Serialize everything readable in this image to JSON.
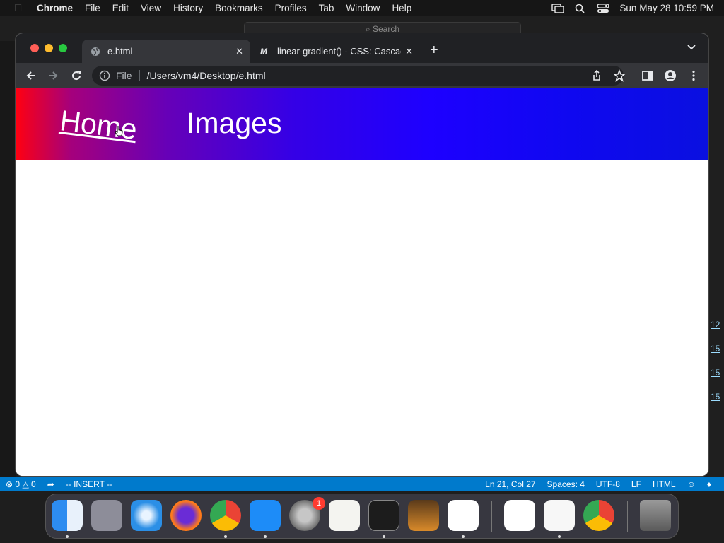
{
  "menubar": {
    "app_name": "Chrome",
    "menus": [
      "File",
      "Edit",
      "View",
      "History",
      "Bookmarks",
      "Profiles",
      "Tab",
      "Window",
      "Help"
    ],
    "clock": "Sun May 28  10:59 PM"
  },
  "background_editor": {
    "search_placeholder": "⌕ Search",
    "status": {
      "errors": "0",
      "warnings": "0",
      "mode": "-- INSERT --",
      "position": "Ln 21, Col 27",
      "spaces": "Spaces: 4",
      "encoding": "UTF-8",
      "eol": "LF",
      "language": "HTML"
    },
    "line_refs": [
      "12",
      "15",
      "15",
      "15"
    ]
  },
  "browser": {
    "tabs": [
      {
        "title": "e.html",
        "active": true,
        "icon": "globe-icon"
      },
      {
        "title": "linear-gradient() - CSS: Cascading",
        "active": false,
        "icon": "mdn-icon"
      }
    ],
    "address": {
      "scheme_label": "File",
      "url": "/Users/vm4/Desktop/e.html"
    }
  },
  "page": {
    "nav": {
      "home": "Home",
      "images": "Images"
    },
    "colors": {
      "gradient_start": "#ff0010",
      "gradient_end": "#0a10e0",
      "text": "#ffffff"
    }
  },
  "dock": {
    "apps": [
      "Finder",
      "Launchpad",
      "Safari",
      "Firefox",
      "Google Chrome",
      "App Store",
      "System Preferences",
      "TextEdit",
      "Terminal",
      "GarageBand",
      "Visual Studio Code",
      "Visual Studio",
      "Freeform",
      "Google Chrome",
      "Trash"
    ],
    "settings_badge": "1"
  }
}
